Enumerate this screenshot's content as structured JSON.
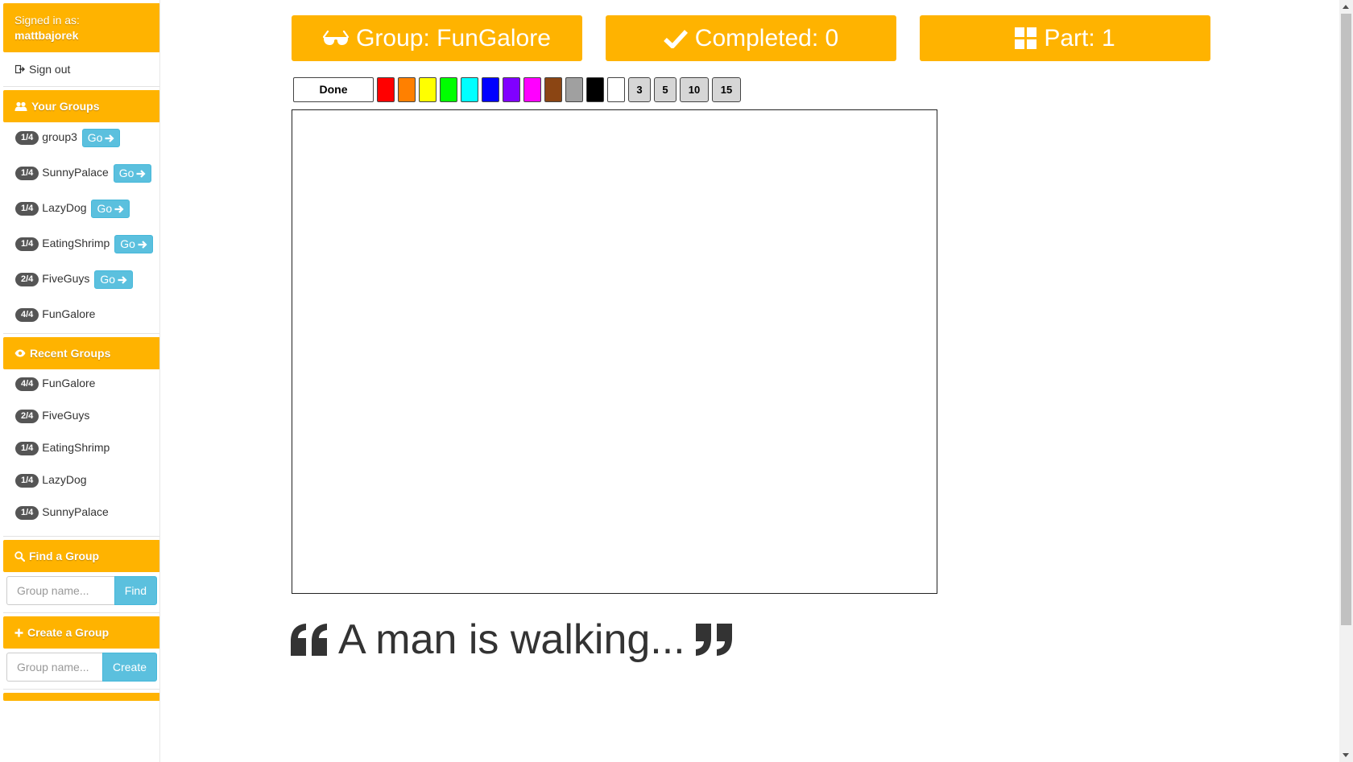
{
  "sidebar": {
    "signed_in_label": "Signed in as:",
    "username": "mattbajorek",
    "sign_out": "Sign out",
    "your_groups": {
      "title": "Your Groups",
      "icon": "users-icon",
      "items": [
        {
          "count": "1/4",
          "name": "group3",
          "go": "Go"
        },
        {
          "count": "1/4",
          "name": "SunnyPalace",
          "go": "Go"
        },
        {
          "count": "1/4",
          "name": "LazyDog",
          "go": "Go"
        },
        {
          "count": "1/4",
          "name": "EatingShrimp",
          "go": "Go"
        },
        {
          "count": "2/4",
          "name": "FiveGuys",
          "go": "Go"
        },
        {
          "count": "4/4",
          "name": "FunGalore"
        }
      ]
    },
    "recent_groups": {
      "title": "Recent Groups",
      "icon": "eye-icon",
      "items": [
        {
          "count": "4/4",
          "name": "FunGalore"
        },
        {
          "count": "2/4",
          "name": "FiveGuys"
        },
        {
          "count": "1/4",
          "name": "EatingShrimp"
        },
        {
          "count": "1/4",
          "name": "LazyDog"
        },
        {
          "count": "1/4",
          "name": "SunnyPalace"
        }
      ]
    },
    "find_group": {
      "title": "Find a Group",
      "icon": "search-icon",
      "placeholder": "Group name...",
      "button": "Find"
    },
    "create_group": {
      "title": "Create a Group",
      "icon": "plus-icon",
      "placeholder": "Group name...",
      "button": "Create"
    }
  },
  "header": {
    "group": {
      "label": "Group: FunGalore",
      "icon": "glasses-icon"
    },
    "completed": {
      "label": "Completed: 0",
      "icon": "check-icon"
    },
    "part": {
      "label": "Part: 1",
      "icon": "grid-icon"
    }
  },
  "toolbar": {
    "done_label": "Done",
    "colors": [
      "#ff0000",
      "#ff8000",
      "#ffff00",
      "#00ff00",
      "#00ffff",
      "#0000ff",
      "#8000ff",
      "#ff00ff",
      "#8b4513",
      "#a0a0a0",
      "#000000",
      "#ffffff"
    ],
    "sizes": [
      "3",
      "5",
      "10",
      "15"
    ]
  },
  "prompt": {
    "text": "A man is walking...",
    "open_icon": "quote-left-icon",
    "close_icon": "quote-right-icon"
  },
  "theme": {
    "accent": "#ffb300",
    "info": "#5bc0de",
    "badge": "#555555"
  }
}
